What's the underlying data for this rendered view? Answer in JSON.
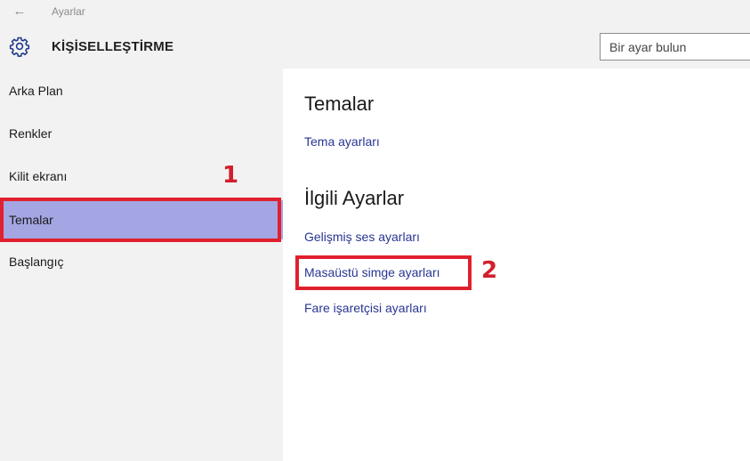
{
  "titlebar": {
    "back_glyph": "←",
    "title": "Ayarlar"
  },
  "header": {
    "section_title": "KİŞİSELLEŞTİRME",
    "search_placeholder": "Bir ayar bulun"
  },
  "sidebar": {
    "items": [
      {
        "label": "Arka Plan",
        "selected": false
      },
      {
        "label": "Renkler",
        "selected": false
      },
      {
        "label": "Kilit ekranı",
        "selected": false
      },
      {
        "label": "Temalar",
        "selected": true
      },
      {
        "label": "Başlangıç",
        "selected": false
      }
    ]
  },
  "content": {
    "themes_heading": "Temalar",
    "theme_settings_link": "Tema ayarları",
    "related_heading": "İlgili Ayarlar",
    "related_links": [
      "Gelişmiş ses ayarları",
      "Masaüstü simge ayarları",
      "Fare işaretçisi ayarları"
    ]
  },
  "annotations": {
    "marker_1": "1",
    "marker_2": "2",
    "color": "#e0202e"
  },
  "colors": {
    "selected_bg": "#a4a6e3",
    "link": "#283593",
    "chrome_bg": "#f2f2f2"
  },
  "icons": {
    "back": "back-arrow-icon",
    "header": "gear-icon"
  }
}
